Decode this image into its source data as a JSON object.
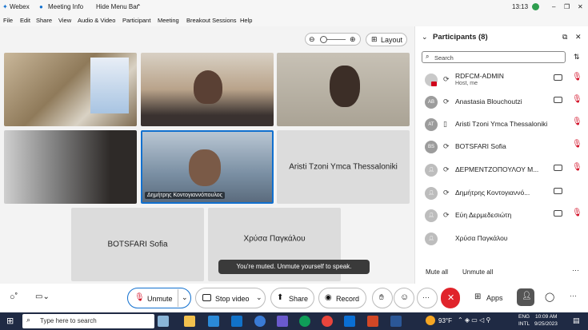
{
  "titlebar": {
    "app": "Webex",
    "meeting_info": "Meeting Info",
    "hide_menu": "Hide Menu Bar",
    "time": "13:13"
  },
  "menu": [
    "File",
    "Edit",
    "Share",
    "View",
    "Audio & Video",
    "Participant",
    "Meeting",
    "Breakout Sessions",
    "Help"
  ],
  "stage": {
    "layout_label": "Layout",
    "tiles": {
      "aristi": "Aristi Tzoni Ymca Thessaloniki",
      "dimitris_tag": "Δημήτρης Κοντογιαννόπουλος",
      "botsfari": "BOTSFARI Sofia",
      "chrysa": "Χρύσα Παγκάλου"
    },
    "toast": "You're muted. Unmute yourself to speak."
  },
  "participants": {
    "title": "Participants (8)",
    "search_placeholder": "Search",
    "list": [
      {
        "initials": "",
        "name": "RDFCM-ADMIN",
        "sub": "Host, me"
      },
      {
        "initials": "AB",
        "name": "Anastasia Blouchoutzi",
        "sub": ""
      },
      {
        "initials": "AT",
        "name": "Aristi Tzoni Ymca Thessaloniki",
        "sub": ""
      },
      {
        "initials": "BS",
        "name": "BOTSFARI Sofia",
        "sub": ""
      },
      {
        "initials": "",
        "name": "ΔΕΡΜΕΝΤΖΟΠΟΥΛΟΥ Μ...",
        "sub": ""
      },
      {
        "initials": "",
        "name": "Δημήτρης Κοντογιαννό...",
        "sub": ""
      },
      {
        "initials": "",
        "name": "Εύη Δερμεδεσιώτη",
        "sub": ""
      },
      {
        "initials": "",
        "name": "Χρύσα Παγκάλου",
        "sub": ""
      }
    ],
    "mute_all": "Mute all",
    "unmute_all": "Unmute all"
  },
  "controls": {
    "unmute": "Unmute",
    "stop_video": "Stop video",
    "share": "Share",
    "record": "Record",
    "apps": "Apps"
  },
  "taskbar": {
    "search_placeholder": "Type here to search",
    "weather": "93°F",
    "lang": "ENG",
    "region": "INTL",
    "clock_time": "10:09 AM",
    "clock_date": "9/25/2023"
  },
  "colors": {
    "accent": "#1170cf",
    "muted_red": "#d0021b",
    "end_red": "#e0242b",
    "taskbar": "#1f2a44"
  }
}
